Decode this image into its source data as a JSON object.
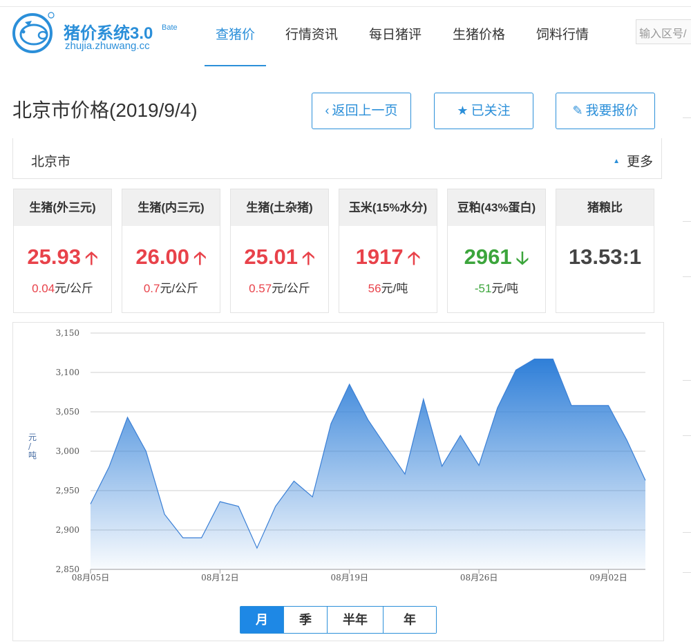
{
  "header": {
    "logo_name": "猪价系统3.0",
    "logo_version": "Bate",
    "logo_url": "zhujia.zhuwang.cc",
    "nav": [
      {
        "label": "查猪价",
        "active": true
      },
      {
        "label": "行情资讯",
        "active": false
      },
      {
        "label": "每日猪评",
        "active": false
      },
      {
        "label": "生猪价格",
        "active": false
      },
      {
        "label": "饲料行情",
        "active": false
      }
    ],
    "search_placeholder": "输入区号/"
  },
  "page": {
    "title": "北京市价格(2019/9/4)",
    "buttons": {
      "back": "返回上一页",
      "follow": "已关注",
      "report": "我要报价"
    },
    "city": "北京市",
    "more": "更多"
  },
  "cards": [
    {
      "title": "生猪(外三元)",
      "price": "25.93",
      "trend": "up",
      "change_value": "0.04",
      "change_unit": "元/公斤"
    },
    {
      "title": "生猪(内三元)",
      "price": "26.00",
      "trend": "up",
      "change_value": "0.7",
      "change_unit": "元/公斤"
    },
    {
      "title": "生猪(土杂猪)",
      "price": "25.01",
      "trend": "up",
      "change_value": "0.57",
      "change_unit": "元/公斤"
    },
    {
      "title": "玉米(15%水分)",
      "price": "1917",
      "trend": "up",
      "change_value": "56",
      "change_unit": "元/吨"
    },
    {
      "title": "豆粕(43%蛋白)",
      "price": "2961",
      "trend": "down",
      "change_value": "-51",
      "change_unit": "元/吨"
    },
    {
      "title": "猪粮比",
      "price": "13.53:1",
      "trend": "none",
      "change_value": "",
      "change_unit": ""
    }
  ],
  "colors": {
    "accent": "#2b8fd9",
    "up": "#e8424a",
    "down": "#3ca53c",
    "series_line": "#3a7fd5"
  },
  "chart_data": {
    "type": "area",
    "ylabel": "元/吨",
    "ylim": [
      2850,
      3150
    ],
    "yticks": [
      "3,150",
      "3,100",
      "3,050",
      "3,000",
      "2,950",
      "2,900",
      "2,850"
    ],
    "yticks_values": [
      3150,
      3100,
      3050,
      3000,
      2950,
      2900,
      2850
    ],
    "xticks": [
      "08月05日",
      "08月12日",
      "08月19日",
      "08月26日",
      "09月02日"
    ],
    "xticks_index": [
      0,
      7,
      14,
      21,
      28
    ],
    "x_count": 31,
    "grid": true,
    "series": [
      {
        "values": [
          2933,
          2980,
          3043,
          3000,
          2920,
          2890,
          2890,
          2936,
          2930,
          2877,
          2930,
          2962,
          2942,
          3035,
          3085,
          3040,
          3005,
          2971,
          3066,
          2981,
          3020,
          2982,
          3055,
          3103,
          3117,
          3117,
          3058,
          3058,
          3058,
          3014,
          2963
        ]
      }
    ]
  },
  "periods": [
    {
      "label": "月",
      "active": true
    },
    {
      "label": "季",
      "active": false
    },
    {
      "label": "半年",
      "active": false
    },
    {
      "label": "年",
      "active": false
    }
  ]
}
